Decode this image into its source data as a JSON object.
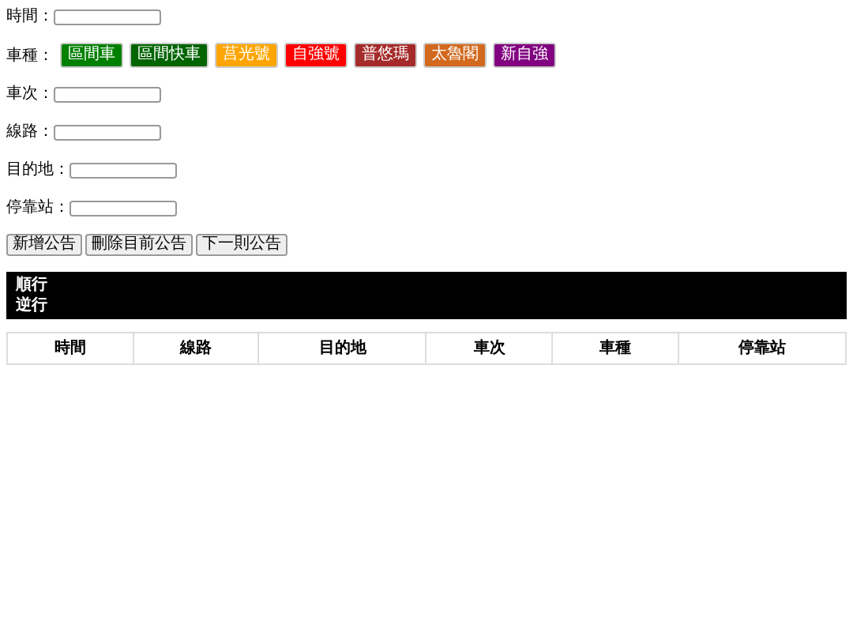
{
  "fields_before": [
    {
      "label": "時間："
    }
  ],
  "train_types": {
    "label": "車種：",
    "options": [
      {
        "label": "區間車",
        "color": "#008000"
      },
      {
        "label": "區間快車",
        "color": "#006400"
      },
      {
        "label": "莒光號",
        "color": "#ffa500"
      },
      {
        "label": "自強號",
        "color": "#ff0000"
      },
      {
        "label": "普悠瑪",
        "color": "#a52a2a"
      },
      {
        "label": "太魯閣",
        "color": "#d2691e"
      },
      {
        "label": "新自強",
        "color": "#800080"
      }
    ]
  },
  "fields_after": [
    {
      "label": "車次："
    },
    {
      "label": "線路："
    },
    {
      "label": "目的地："
    },
    {
      "label": "停靠站："
    }
  ],
  "buttons": [
    "新增公告",
    "刪除目前公告",
    "下一則公告"
  ],
  "directions": [
    "順行",
    "逆行"
  ],
  "table": {
    "columns": [
      "時間",
      "線路",
      "目的地",
      "車次",
      "車種",
      "停靠站"
    ]
  }
}
